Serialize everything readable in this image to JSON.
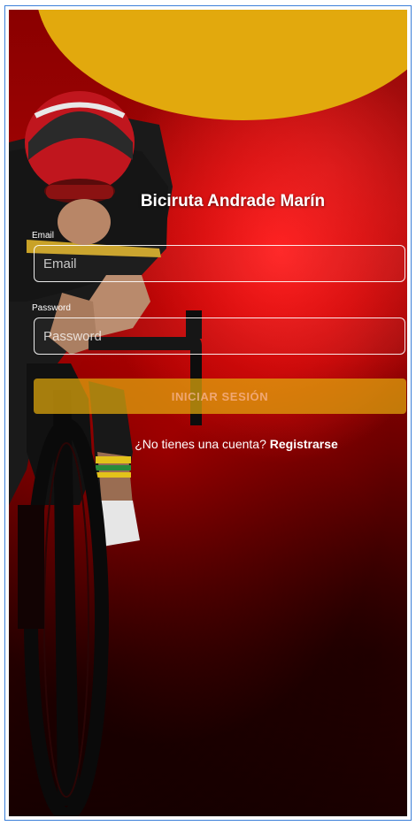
{
  "app": {
    "title": "Biciruta Andrade Marín"
  },
  "login_form": {
    "email_label": "Email",
    "email_placeholder": "Email",
    "email_value": "",
    "password_label": "Password",
    "password_placeholder": "Password",
    "password_value": "",
    "submit_label": "INICIAR SESIÓN"
  },
  "register": {
    "prompt": "¿No tienes una cuenta?",
    "link_label": "Registrarse"
  },
  "colors": {
    "accent": "#e2a90d",
    "background": "#a30404",
    "frame_border": "#3b7fd9"
  }
}
